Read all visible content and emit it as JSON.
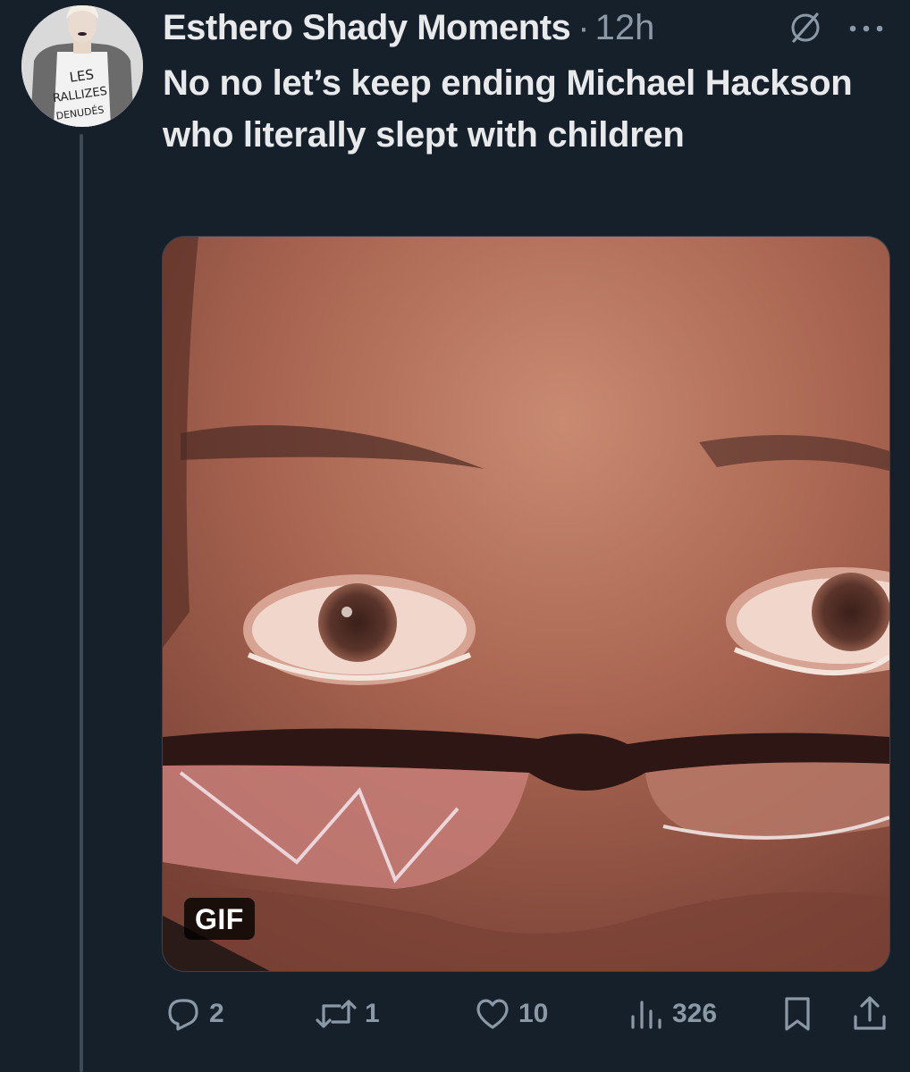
{
  "tweet": {
    "display_name": "Esthero Shady Moments",
    "separator": "·",
    "time": "12h",
    "text": "No no let’s keep ending Michael Hackson who literally slept with children",
    "avatar": {
      "shirt_text": [
        "LES",
        "RALLIZES",
        "DENUDÉS"
      ]
    },
    "media": {
      "badge": "GIF"
    },
    "actions": {
      "reply_count": "2",
      "retweet_count": "1",
      "like_count": "10",
      "view_count": "326"
    }
  },
  "colors": {
    "background": "#15202b",
    "primary_text": "#e7e9ea",
    "secondary_text": "#8b98a5",
    "thread_line": "#3d4a56",
    "border": "#38444d"
  },
  "icons": {
    "grok": "grok-icon",
    "more": "more-horizontal-icon",
    "reply": "reply-icon",
    "retweet": "retweet-icon",
    "like": "heart-icon",
    "views": "views-icon",
    "bookmark": "bookmark-icon",
    "share": "share-icon"
  }
}
